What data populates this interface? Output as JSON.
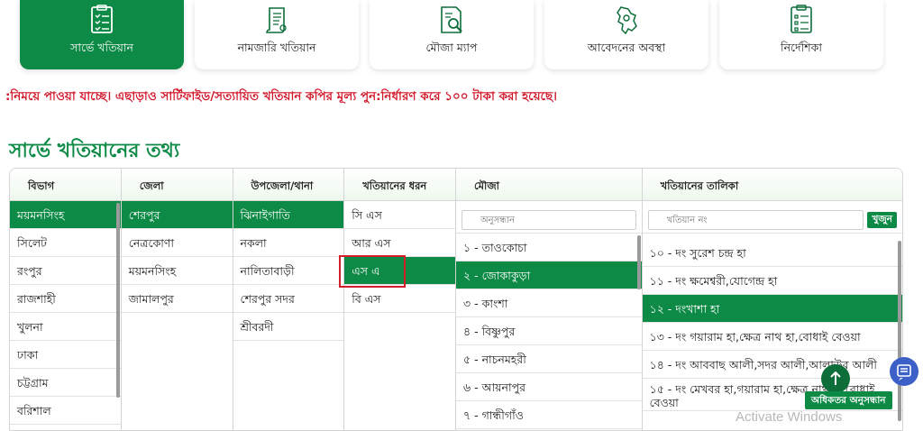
{
  "tiles": [
    {
      "label": "সার্ভে খতিয়ান",
      "icon": "survey-record-icon",
      "active": true
    },
    {
      "label": "নামজারি খতিয়ান",
      "icon": "scroll-document-icon",
      "active": false
    },
    {
      "label": "মৌজা ম্যাপ",
      "icon": "map-search-icon",
      "active": false
    },
    {
      "label": "আবেদনের অবস্থা",
      "icon": "region-map-icon",
      "active": false
    },
    {
      "label": "নির্দেশিকা",
      "icon": "checklist-icon",
      "active": false
    }
  ],
  "notice": ":নিময়ে পাওয়া যাচ্ছে। এছাড়াও সার্টিফাইড/সত্যায়িত খতিয়ান কপির মূল্য পুন:নির্ধারণ করে ১০০ টাকা করা হয়েছে।",
  "section_title": "সার্ভে খতিয়ানের তথ্য",
  "columns": {
    "division": {
      "header": "বিভাগ",
      "items": [
        "ময়মনসিংহ",
        "সিলেট",
        "রংপুর",
        "রাজশাহী",
        "খুলনা",
        "ঢাকা",
        "চট্টগ্রাম",
        "বরিশাল"
      ],
      "selected": 0
    },
    "district": {
      "header": "জেলা",
      "items": [
        "শেরপুর",
        "নেত্রকোণা",
        "ময়মনসিংহ",
        "জামালপুর"
      ],
      "selected": 0
    },
    "upazila": {
      "header": "উপজেলা/থানা",
      "items": [
        "ঝিনাইগাতি",
        "নকলা",
        "নালিতাবাড়ী",
        "শেরপুর সদর",
        "শ্রীবরদী"
      ],
      "selected": 0
    },
    "khatian_type": {
      "header": "খতিয়ানের ধরন",
      "items": [
        "সি এস",
        "আর এস",
        "এস এ",
        "বি এস"
      ],
      "selected": 2
    },
    "mouza": {
      "header": "মৌজা",
      "search_placeholder": "অনুসন্ধান",
      "items": [
        "১ - তাওকোচা",
        "২ - জোকাকুড়া",
        "৩ - কাংশা",
        "৪ - বিষ্ণুপুর",
        "৫ - নাচনমহরী",
        "৬ - আয়নাপুর",
        "৭ - গান্ধীগাঁও"
      ],
      "selected": 1
    },
    "khatian_list": {
      "header": "খতিয়ানের তালিকা",
      "search_placeholder": "খতিয়ান নং",
      "search_button": "খুজুন",
      "items": [
        "১০ - দং সুরেশ চন্দ্র হা",
        "১১ - দং ক্ষমেশ্বরী,যোগেন্দ্র হা",
        "১২ - দংখাশা হা",
        "১৩ - দং গয়ারাম হা,ক্ষেত্র নাথ হা,বোধাই বেওয়া",
        "১৪ - দং আববাছ আলী,সদর আলী,আলাউর আলী",
        "১৫ - দং মেখবর হা,গয়ারাম হা,ক্ষেত্র নাথ হা,বোধাই বেওয়া"
      ],
      "selected": 2
    }
  },
  "advanced_search": "অধিকতর অনুসন্ধান",
  "watermark": "Activate Windows",
  "colors": {
    "primary": "#0d8a46",
    "notice": "#d3192c",
    "highlight": "#d31f2a",
    "chat": "#3d5fc8"
  }
}
